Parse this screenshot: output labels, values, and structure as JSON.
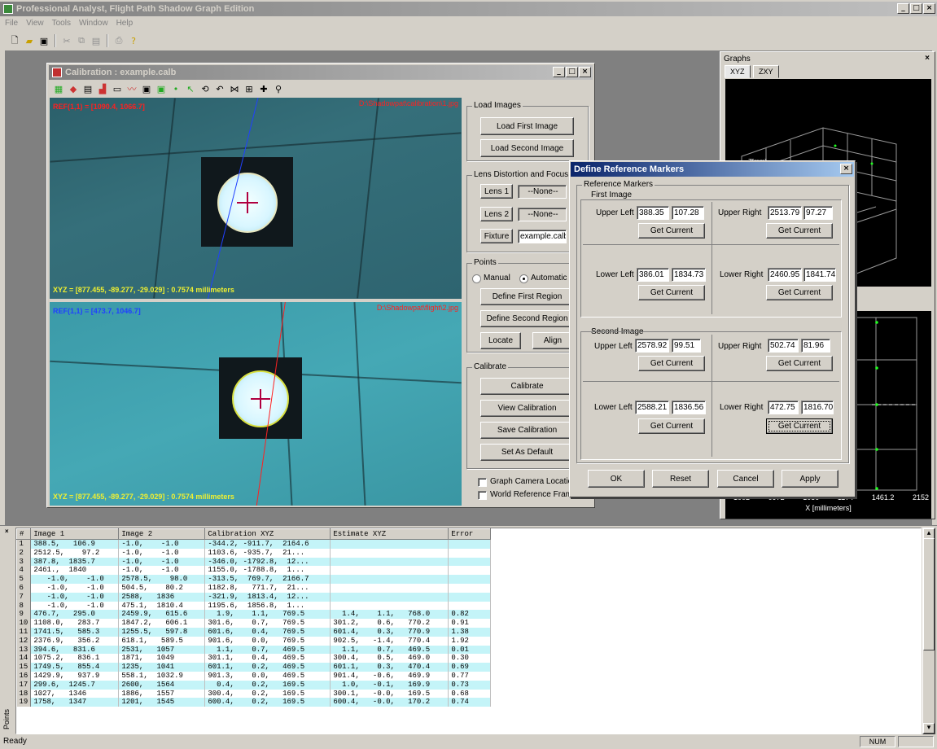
{
  "app": {
    "title": "Professional Analyst, Flight Path Shadow Graph Edition",
    "menu": [
      "File",
      "View",
      "Tools",
      "Window",
      "Help"
    ],
    "toolbar_icons": [
      "new-icon",
      "open-icon",
      "save-icon",
      "cut-icon",
      "copy-icon",
      "paste-icon",
      "print-icon",
      "help-icon"
    ]
  },
  "calibration": {
    "title": "Calibration : example.calb",
    "toolbar_icons": [
      "grid-icon",
      "color-icon",
      "table-icon",
      "chart-icon",
      "minus-icon",
      "line-icon",
      "image-icon",
      "image2-icon",
      "point-icon",
      "arrow-icon",
      "rotate-icon",
      "undo-icon",
      "fit-icon",
      "frame-icon",
      "crosshair-icon",
      "zoom-icon"
    ],
    "top_image": {
      "ref_label": "REF(1,1) = [1090.4, 1066.7]",
      "filename": "D:\\Shadowpat\\calibration\\1.jpg",
      "xyz_label": "XYZ = [877.455, -89.277, -29.029]",
      "distance": ": 0.7574 millimeters"
    },
    "bottom_image": {
      "ref_label": "REF(1,1) = [473.7, 1046.7]",
      "filename": "D:\\Shadowpat\\flight\\2.jpg",
      "xyz_label": "XYZ = [877.455, -89.277, -29.029]",
      "distance": ": 0.7574 millimeters"
    },
    "load_images": {
      "group": "Load Images",
      "first": "Load First Image",
      "second": "Load Second Image"
    },
    "lens": {
      "group": "Lens Distortion and Focus",
      "lens1": "Lens 1",
      "lens1_value": "--None--",
      "lens2": "Lens 2",
      "lens2_value": "--None--",
      "fixture": "Fixture",
      "fixture_value": "example.calb"
    },
    "points": {
      "group": "Points",
      "manual": "Manual",
      "auto": "Automatic",
      "define_first": "Define First Region",
      "define_second": "Define Second Region",
      "locate": "Locate",
      "align": "Align"
    },
    "calibrate": {
      "group": "Calibrate",
      "calibrate": "Calibrate",
      "view": "View Calibration",
      "save": "Save Calibration",
      "default": "Set As Default",
      "graph_camera": "Graph Camera Location",
      "world_ref": "World Reference Frame"
    }
  },
  "graphs": {
    "title": "Graphs",
    "tabs": [
      "XYZ",
      "ZXY"
    ],
    "axis_label": "X [millimeters]",
    "ticks": [
      "1002",
      "0972",
      "1050",
      "1174",
      "1461.2",
      "2152"
    ],
    "zlabel": "Z[mm]"
  },
  "dialog": {
    "title": "Define Reference Markers",
    "group": "Reference Markers",
    "first_image": "First Image",
    "second_image": "Second Image",
    "get_current": "Get Current",
    "upper_left": "Upper Left",
    "upper_right": "Upper Right",
    "lower_left": "Lower Left",
    "lower_right": "Lower Right",
    "first": {
      "ul": [
        "388.35",
        "107.28"
      ],
      "ur": [
        "2513.79",
        "97.27"
      ],
      "ll": [
        "386.01",
        "1834.73"
      ],
      "lr": [
        "2460.95",
        "1841.74"
      ]
    },
    "second": {
      "ul": [
        "2578.92",
        "99.51"
      ],
      "ur": [
        "502.74",
        "81.96"
      ],
      "ll": [
        "2588.21",
        "1836.56"
      ],
      "lr": [
        "472.75",
        "1816.70"
      ]
    },
    "ok": "OK",
    "reset": "Reset",
    "cancel": "Cancel",
    "apply": "Apply"
  },
  "points_table": {
    "side_label": "Points",
    "headers": [
      "#",
      "Image 1",
      "Image 2",
      "Calibration XYZ",
      "Estimate XYZ",
      "Error"
    ],
    "rows": [
      [
        "1",
        "388.5,   106.9",
        "-1.0,    -1.0",
        "-344.2, -911.7,  2164.6",
        "",
        ""
      ],
      [
        "2",
        "2512.5,    97.2",
        "-1.0,    -1.0",
        "1103.6, -935.7,  21...",
        "",
        ""
      ],
      [
        "3",
        "387.8,  1835.7",
        "-1.0,    -1.0",
        "-346.0, -1792.8,  12...",
        "",
        ""
      ],
      [
        "4",
        "2461.,  1840",
        "-1.0,    -1.0",
        "1155.0, -1788.8,  1...",
        "",
        ""
      ],
      [
        "5",
        "   -1.0,    -1.0",
        "2578.5,    98.0",
        "-313.5,  769.7,  2166.7",
        "",
        ""
      ],
      [
        "6",
        "   -1.0,    -1.0",
        "504.5,    80.2",
        "1182.8,   771.7,  21...",
        "",
        ""
      ],
      [
        "7",
        "   -1.0,    -1.0",
        "2588,   1836",
        "-321.9,  1813.4,  12...",
        "",
        ""
      ],
      [
        "8",
        "   -1.0,    -1.0",
        "475.1,  1810.4",
        "1195.6,  1856.8,  1...",
        "",
        ""
      ],
      [
        "9",
        "476.7,   295.0",
        "2459.9,   615.6",
        "  1.9,    1.1,   769.5",
        "  1.4,    1.1,   768.0",
        "0.82"
      ],
      [
        "10",
        "1108.0,   283.7",
        "1847.2,   606.1",
        "301.6,    0.7,   769.5",
        "301.2,    0.6,   770.2",
        "0.91"
      ],
      [
        "11",
        "1741.5,   585.3",
        "1255.5,   597.8",
        "601.6,    0.4,   769.5",
        "601.4,    0.3,   770.9",
        "1.38"
      ],
      [
        "12",
        "2376.9,   356.2",
        "618.1,   589.5",
        "901.6,    0.0,   769.5",
        "902.5,   -1.4,   770.4",
        "1.92"
      ],
      [
        "13",
        "394.6,   831.6",
        "2531,   1057",
        "  1.1,    0.7,   469.5",
        "  1.1,    0.7,   469.5",
        "0.01"
      ],
      [
        "14",
        "1075.2,   836.1",
        "1871,   1049",
        "301.1,    0.4,   469.5",
        "300.4,    0.5,   469.0",
        "0.30"
      ],
      [
        "15",
        "1749.5,   855.4",
        "1235,   1041",
        "601.1,    0.2,   469.5",
        "601.1,    0.3,   470.4",
        "0.69"
      ],
      [
        "16",
        "1429.9,   937.9",
        "558.1,  1032.9",
        "901.3,    0.0,   469.5",
        "901.4,   -0.6,   469.9",
        "0.77"
      ],
      [
        "17",
        "299.6,  1245.7",
        "2600,   1564",
        "  0.4,    0.2,   169.5",
        "  1.0,   -0.1,   169.9",
        "0.73"
      ],
      [
        "18",
        "1027,   1346",
        "1886,   1557",
        "300.4,    0.2,   169.5",
        "300.1,   -0.0,   169.5",
        "0.68"
      ],
      [
        "19",
        "1758,   1347",
        "1201,   1545",
        "600.4,    0.2,   169.5",
        "600.4,   -0.0,   170.2",
        "0.74"
      ]
    ]
  },
  "status": {
    "left": "Ready",
    "num": "NUM"
  }
}
